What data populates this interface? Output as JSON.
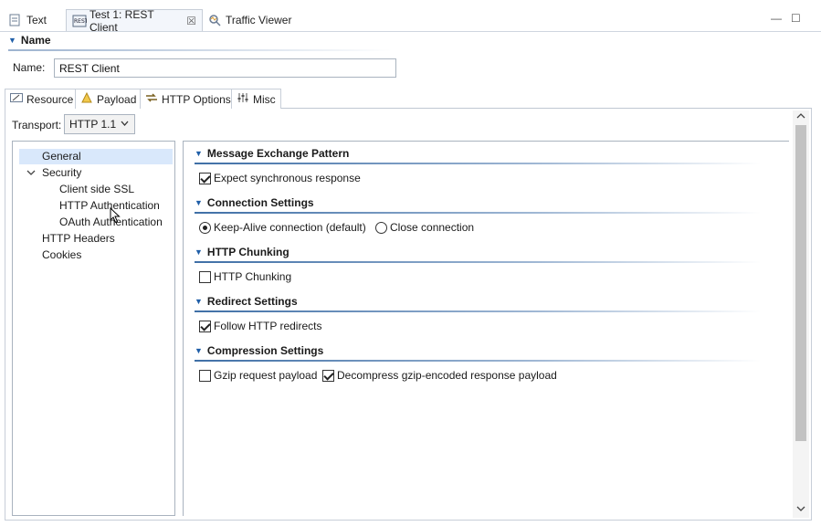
{
  "editor_tabs": [
    {
      "label": "Text",
      "icon": "document-icon"
    },
    {
      "label": "Test 1: REST Client",
      "icon": "rest-icon",
      "close": "☒"
    },
    {
      "label": "Traffic Viewer",
      "icon": "traffic-viewer-icon"
    }
  ],
  "window_controls": {
    "minimize": "—",
    "maximize": "☐"
  },
  "name_section": {
    "title": "Name",
    "label": "Name:",
    "value": "REST Client"
  },
  "inner_tabs": [
    {
      "label": "Resource",
      "icon": "pencil-icon"
    },
    {
      "label": "Payload",
      "icon": "payload-icon"
    },
    {
      "label": "HTTP Options",
      "icon": "http-options-icon"
    },
    {
      "label": "Misc",
      "icon": "sliders-icon"
    }
  ],
  "transport": {
    "label": "Transport:",
    "value": "HTTP 1.1"
  },
  "tree": {
    "general": "General",
    "security": "Security",
    "client_ssl": "Client side SSL",
    "http_auth": "HTTP Authentication",
    "oauth": "OAuth Authentication",
    "http_headers": "HTTP Headers",
    "cookies": "Cookies"
  },
  "groups": {
    "mep": {
      "title": "Message Exchange Pattern",
      "option": "Expect synchronous response",
      "checked": true
    },
    "connection": {
      "title": "Connection Settings",
      "keepalive": "Keep-Alive connection (default)",
      "close": "Close connection",
      "selected": "keepalive"
    },
    "chunking": {
      "title": "HTTP Chunking",
      "option": "HTTP Chunking",
      "checked": false
    },
    "redirect": {
      "title": "Redirect Settings",
      "option": "Follow HTTP redirects",
      "checked": true
    },
    "compression": {
      "title": "Compression Settings",
      "gzip": "Gzip request payload",
      "gzip_checked": false,
      "decompress": "Decompress gzip-encoded response payload",
      "decompress_checked": true
    }
  },
  "colors": {
    "accent": "#1f5ea8",
    "selection": "#d9e8fb"
  }
}
